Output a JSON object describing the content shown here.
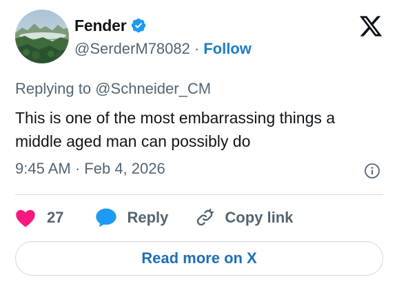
{
  "author": {
    "display_name": "Fender",
    "handle": "@SerderM78082",
    "separator": "·",
    "follow_label": "Follow",
    "verified": true
  },
  "reply_context": {
    "prefix": "Replying to",
    "target_handle": "@Schneider_CM"
  },
  "tweet": {
    "text": "This is one of the most embarrassing things a middle aged man can possibly do",
    "time": "9:45 AM",
    "separator": "·",
    "date": "Feb 4, 2026"
  },
  "actions": {
    "like_count": "27",
    "reply_label": "Reply",
    "copy_link_label": "Copy link"
  },
  "read_more_label": "Read more on X",
  "icons": {
    "logo": "x-logo-icon",
    "verified": "verified-badge-icon",
    "info": "info-icon",
    "like": "heart-icon",
    "reply": "speech-bubble-icon",
    "copy": "link-icon"
  },
  "colors": {
    "verified_blue": "#1d9bf0",
    "follow_blue": "#1d7bc4",
    "heart_pink": "#f91880",
    "reply_blue": "#1d9bf0",
    "secondary_text": "#536471",
    "primary_text": "#0f1419",
    "border": "#cfd9de"
  }
}
